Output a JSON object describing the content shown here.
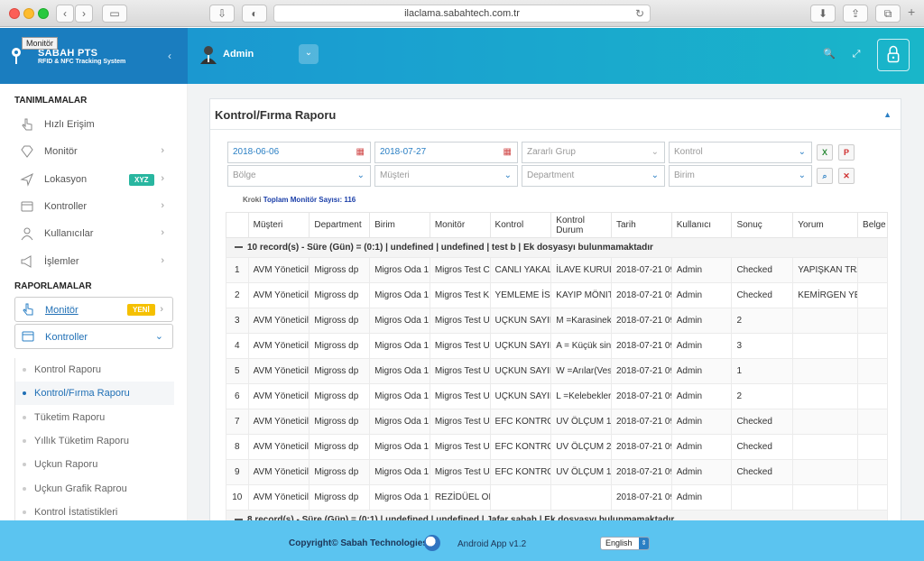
{
  "browser": {
    "url": "ilaclama.sabahtech.com.tr"
  },
  "header": {
    "brand_name": "SABAH PTS",
    "brand_sub": "RFID & NFC Tracking System",
    "tooltip": "Monitör",
    "user": "Admin"
  },
  "sidebar": {
    "section1": "TANIMLAMALAR",
    "items1": [
      {
        "label": "Hızlı Erişim"
      },
      {
        "label": "Monitör"
      },
      {
        "label": "Lokasyon",
        "badge": "XYZ"
      },
      {
        "label": "Kontroller"
      },
      {
        "label": "Kullanıcılar"
      },
      {
        "label": "İşlemler"
      }
    ],
    "section2": "RAPORLAMALAR",
    "items2": [
      {
        "label": "Monitör",
        "badge": "YENİ"
      },
      {
        "label": "Kontroller"
      }
    ],
    "submenu": [
      "Kontrol Raporu",
      "Kontrol/Fırma Raporu",
      "Tüketim Raporu",
      "Yıllık Tüketim Raporu",
      "Uçkun Raporu",
      "Uçkun Grafik Raprou",
      "Kontrol İstatistikleri"
    ],
    "active_index": 1
  },
  "panel": {
    "title": "Kontrol/Fırma Raporu",
    "filters": {
      "date_start": "2018-06-06",
      "date_end": "2018-07-27",
      "zararli_grup": "Zararlı Grup",
      "kontrol": "Kontrol",
      "bolge": "Bölge",
      "musteri": "Müşteri",
      "department": "Department",
      "birim": "Birim"
    },
    "kroki_label": "Kroki",
    "kroki_count": "Toplam Monitör Sayısı: 116"
  },
  "table": {
    "columns": [
      "",
      "Müşteri",
      "Department",
      "Birim",
      "Monitör",
      "Kontrol",
      "Kontrol Durum",
      "Tarih",
      "Kullanıcı",
      "Sonuç",
      "Yorum",
      "Belge"
    ],
    "group1": "10 record(s) - Süre (Gün) = (0:1) | undefined | undefined | test b | Ek dosyasyı bulunmamaktadır",
    "rows": [
      [
        "1",
        "AVM Yöneticili",
        "Migross dp",
        "Migros Oda 1",
        "Migros Test C",
        "CANLI YAKALA",
        "İLAVE KURULU",
        "2018-07-21 09",
        "Admin",
        "Checked",
        "YAPIŞKAN TRA",
        ""
      ],
      [
        "2",
        "AVM Yöneticili",
        "Migross dp",
        "Migros Oda 1",
        "Migros Test K1",
        "YEMLEME İST",
        "KAYIP MÖNITÖ",
        "2018-07-21 09",
        "Admin",
        "Checked",
        "KEMİRGEN YEM",
        ""
      ],
      [
        "3",
        "AVM Yöneticili",
        "Migross dp",
        "Migros Oda 1",
        "Migros Test U",
        "UÇKUN SAYIM",
        "M =Karasinek(",
        "2018-07-21 09",
        "Admin",
        "2",
        "",
        ""
      ],
      [
        "4",
        "AVM Yöneticili",
        "Migross dp",
        "Migros Oda 1",
        "Migros Test U",
        "UÇKUN SAYIM",
        "A = Küçük sine",
        "2018-07-21 09",
        "Admin",
        "3",
        "",
        ""
      ],
      [
        "5",
        "AVM Yöneticili",
        "Migross dp",
        "Migros Oda 1",
        "Migros Test U",
        "UÇKUN SAYIM",
        "W =Arılar(Vesp",
        "2018-07-21 09",
        "Admin",
        "1",
        "",
        ""
      ],
      [
        "6",
        "AVM Yöneticili",
        "Migross dp",
        "Migros Oda 1",
        "Migros Test U",
        "UÇKUN SAYIM",
        "L =Kelebekler",
        "2018-07-21 09",
        "Admin",
        "2",
        "",
        ""
      ],
      [
        "7",
        "AVM Yöneticili",
        "Migross dp",
        "Migros Oda 1",
        "Migros Test U",
        "EFC KONTRO",
        "UV ÖLÇUM 1",
        "2018-07-21 09",
        "Admin",
        "Checked",
        "",
        ""
      ],
      [
        "8",
        "AVM Yöneticili",
        "Migross dp",
        "Migros Oda 1",
        "Migros Test U",
        "EFC KONTRO",
        "UV ÖLÇUM 2",
        "2018-07-21 09",
        "Admin",
        "Checked",
        "",
        ""
      ],
      [
        "9",
        "AVM Yöneticili",
        "Migross dp",
        "Migros Oda 1",
        "Migros Test U",
        "EFC KONTRO",
        "UV ÖLÇUM 1",
        "2018-07-21 09",
        "Admin",
        "Checked",
        "",
        ""
      ],
      [
        "10",
        "AVM Yöneticili",
        "Migross dp",
        "Migros Oda 1",
        "REZİDÜEL OR",
        "",
        "",
        "2018-07-21 09",
        "Admin",
        "",
        "",
        ""
      ]
    ],
    "group2": "8 record(s) - Süre (Gün) = (0:1) | undefined | undefined | Jafar sabah | Ek dosyasyı bulunmamaktadır"
  },
  "footer": {
    "copyright": "Copyright© Sabah Technologies",
    "android": "Android App v1.2",
    "language": "English"
  }
}
